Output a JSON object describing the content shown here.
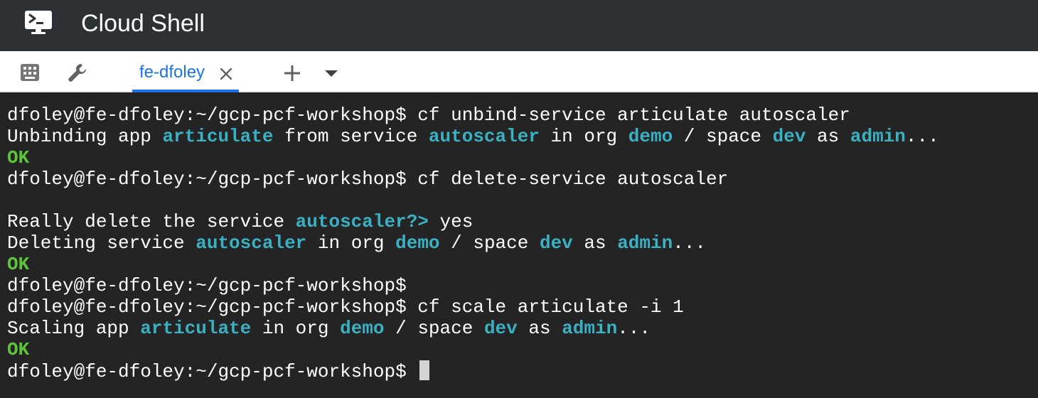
{
  "window": {
    "title": "Cloud Shell",
    "icon": "terminal-console-icon"
  },
  "toolbar": {
    "icons": [
      "keyboard-icon",
      "wrench-icon",
      "add-icon",
      "dropdown-arrow-icon"
    ]
  },
  "tabs": [
    {
      "label": "fe-dfoley",
      "active": true
    }
  ],
  "colors": {
    "titlebar_bg": "#2c3136",
    "terminal_bg": "#242424",
    "highlight": "#3ab0c3",
    "ok": "#5bc43a",
    "active_tab": "#1a73e8"
  },
  "terminal": {
    "prompt": "dfoley@fe-dfoley:~/gcp-pcf-workshop$",
    "lines": [
      {
        "type": "command",
        "text": " cf unbind-service articulate autoscaler"
      },
      {
        "type": "output",
        "parts": [
          "Unbinding app ",
          "articulate",
          " from service ",
          "autoscaler",
          " in org ",
          "demo",
          " / space ",
          "dev",
          " as ",
          "admin",
          "..."
        ]
      },
      {
        "type": "ok",
        "text": "OK"
      },
      {
        "type": "command",
        "text": " cf delete-service autoscaler"
      },
      {
        "type": "blank",
        "text": ""
      },
      {
        "type": "output",
        "parts": [
          "Really delete the service ",
          "autoscaler?>",
          " yes"
        ]
      },
      {
        "type": "output",
        "parts": [
          "Deleting service ",
          "autoscaler",
          " in org ",
          "demo",
          " / space ",
          "dev",
          " as ",
          "admin",
          "..."
        ]
      },
      {
        "type": "ok",
        "text": "OK"
      },
      {
        "type": "command",
        "text": ""
      },
      {
        "type": "command",
        "text": " cf scale articulate -i 1"
      },
      {
        "type": "output",
        "parts": [
          "Scaling app ",
          "articulate",
          " in org ",
          "demo",
          " / space ",
          "dev",
          " as ",
          "admin",
          "..."
        ]
      },
      {
        "type": "ok",
        "text": "OK"
      },
      {
        "type": "command",
        "text": ""
      }
    ]
  }
}
